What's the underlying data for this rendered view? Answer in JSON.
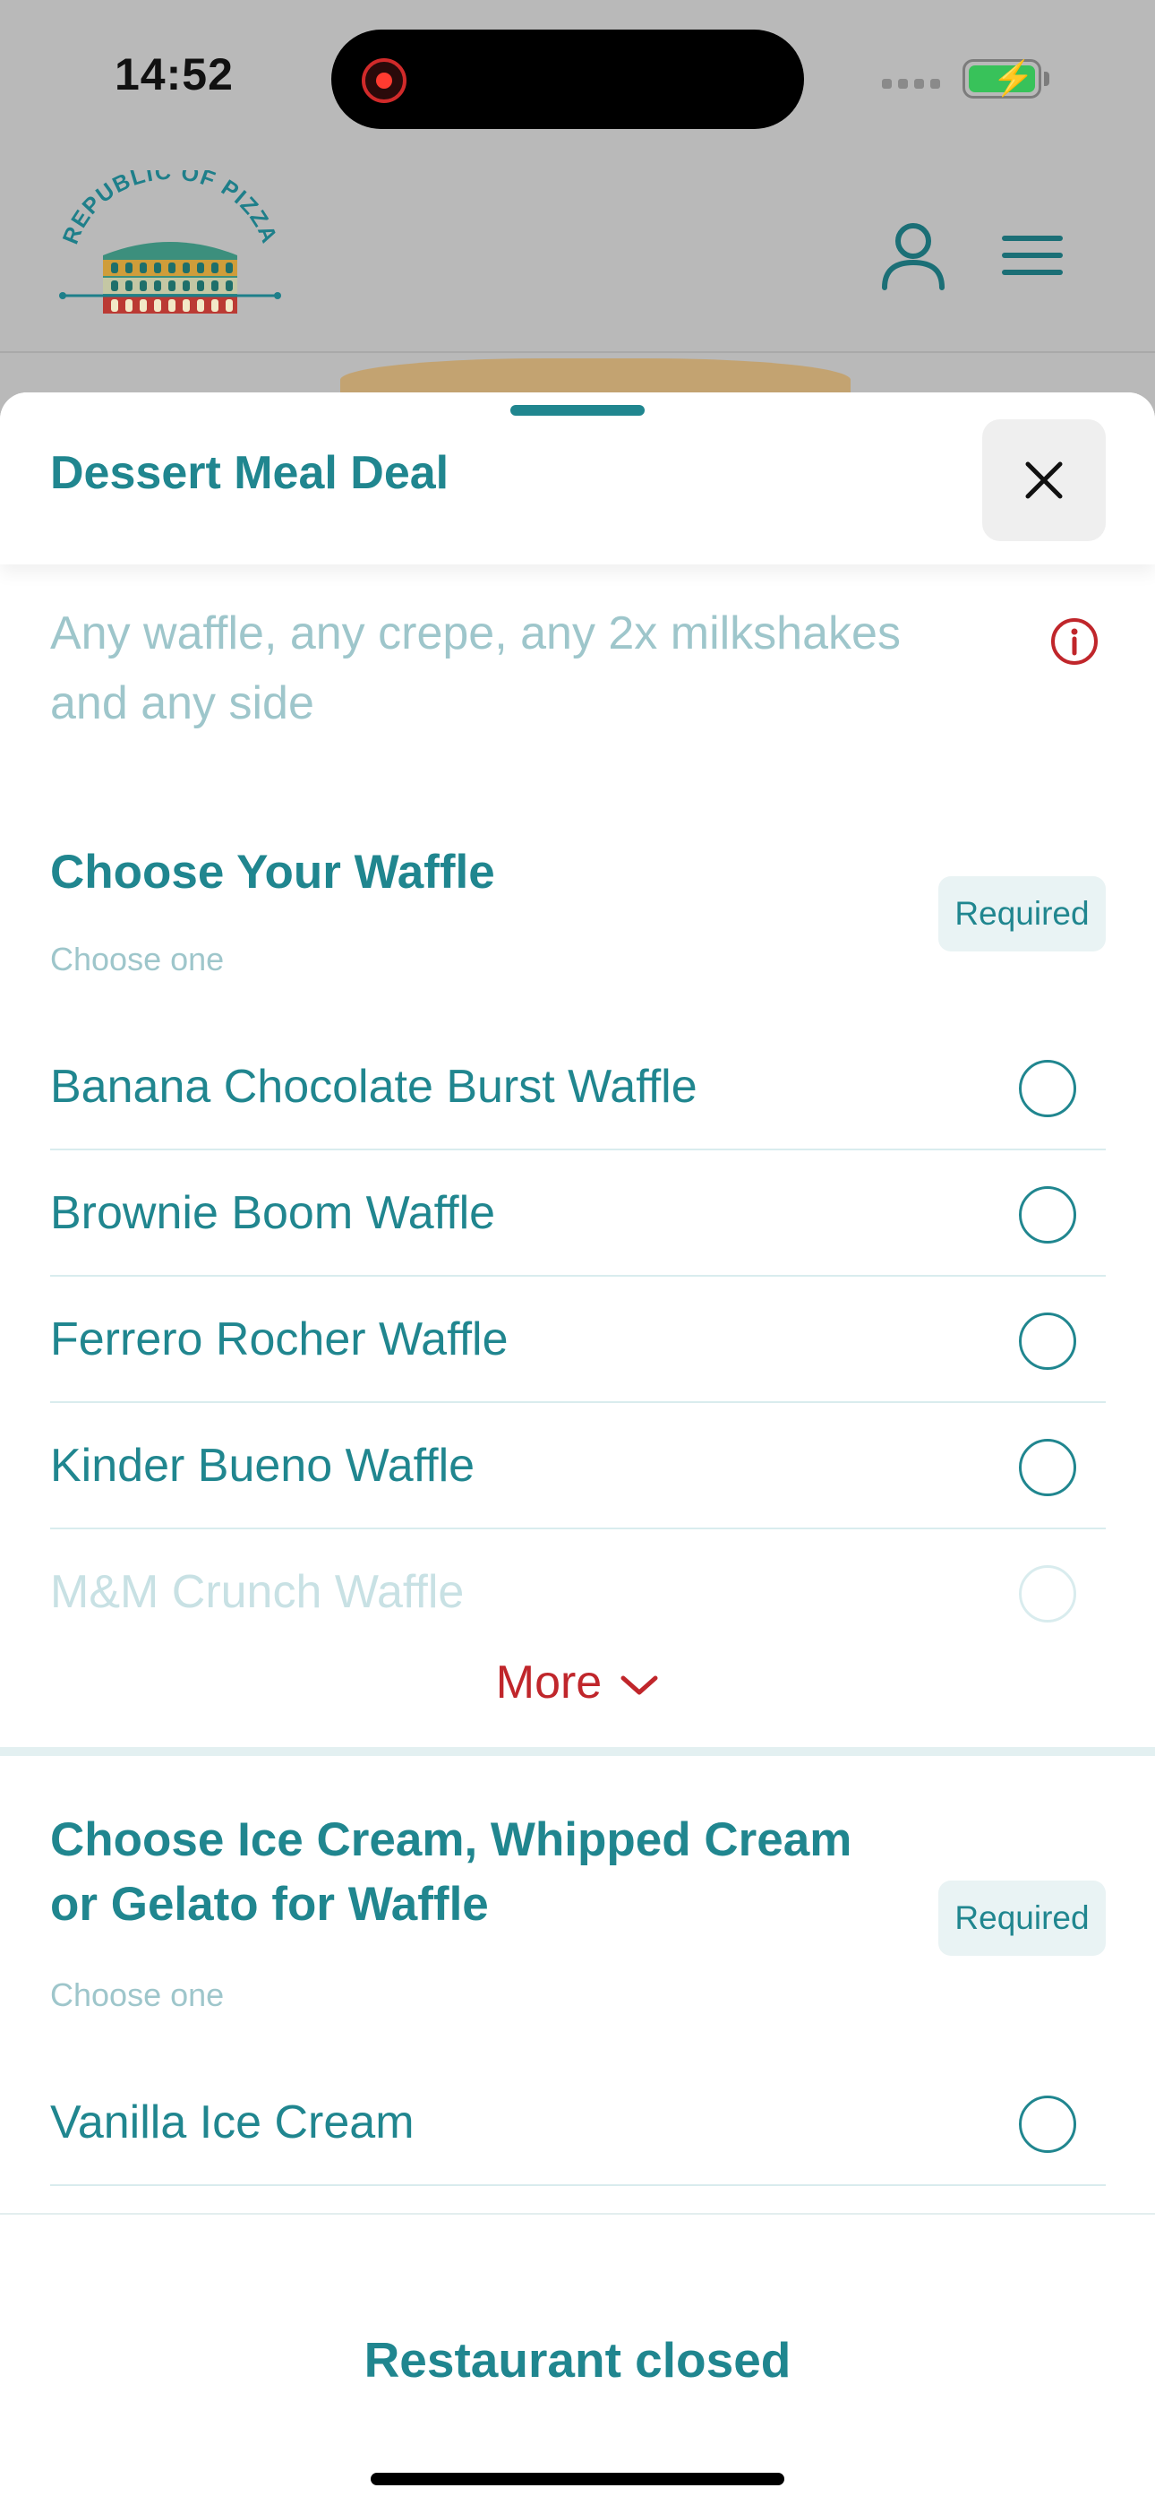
{
  "status_bar": {
    "time": "14:52",
    "battery_icon": "battery-charging-icon"
  },
  "app_header": {
    "logo_text": "REPUBLIC OF PIZZA",
    "user_icon": "user-icon",
    "menu_icon": "hamburger-menu-icon"
  },
  "sheet": {
    "title": "Dessert Meal Deal",
    "close_icon": "close-icon",
    "description": "Any waffle, any crepe, any 2x milkshakes and any side",
    "info_icon": "info-icon"
  },
  "groups": [
    {
      "title": "Choose Your  Waffle",
      "subtitle": "Choose one",
      "badge": "Required",
      "options": [
        "Banana Chocolate Burst Waffle",
        "Brownie Boom Waffle",
        "Ferrero Rocher Waffle",
        "Kinder Bueno Waffle",
        "M&M Crunch Waffle"
      ],
      "more_label": "More"
    },
    {
      "title_line1": "Choose Ice Cream, Whipped Cream",
      "title_line2": "or Gelato for Waffle",
      "subtitle": "Choose one",
      "badge": "Required",
      "options": [
        "Vanilla Ice Cream"
      ]
    }
  ],
  "footer": {
    "status": "Restaurant closed"
  },
  "colors": {
    "accent": "#20868f",
    "muted": "#9ec6cb",
    "alert": "#c0262b",
    "backdrop": "#b9b9b9"
  }
}
